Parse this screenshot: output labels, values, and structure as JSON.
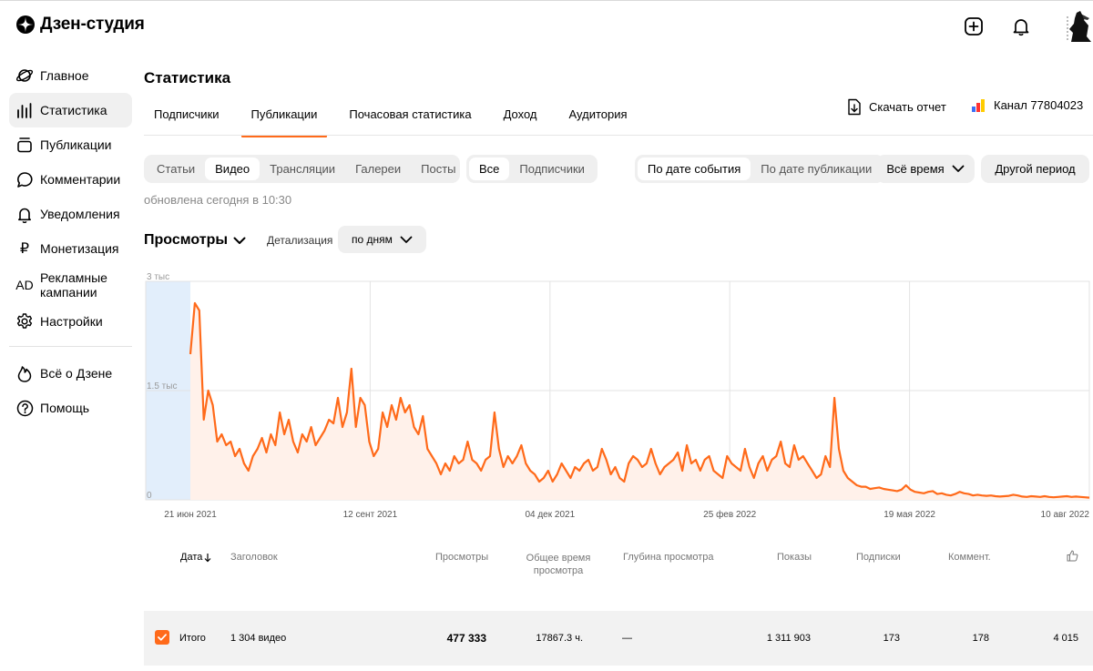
{
  "app": {
    "title": "Дзен-студия",
    "icons": {
      "logo": "zen-logo-icon",
      "add": "add-square-icon",
      "bell": "bell-icon",
      "avatar": "user-avatar"
    }
  },
  "sidebar": {
    "items": [
      {
        "label": "Главное",
        "icon": "planet-icon"
      },
      {
        "label": "Статистика",
        "icon": "bar-chart-icon",
        "active": true
      },
      {
        "label": "Публикации",
        "icon": "publications-icon"
      },
      {
        "label": "Комментарии",
        "icon": "comment-icon"
      },
      {
        "label": "Уведомления",
        "icon": "bell-icon"
      },
      {
        "label": "Монетизация",
        "icon": "ruble-icon"
      },
      {
        "label": "Рекламные кампании",
        "icon": "ad-icon",
        "icon_text": "AD"
      },
      {
        "label": "Настройки",
        "icon": "gear-icon"
      }
    ],
    "secondary": [
      {
        "label": "Всё о Дзене",
        "icon": "flame-icon"
      },
      {
        "label": "Помощь",
        "icon": "help-icon"
      }
    ]
  },
  "page": {
    "title": "Статистика",
    "tabs": [
      "Подписчики",
      "Публикации",
      "Почасовая статистика",
      "Доход",
      "Аудитория"
    ],
    "active_tab": "Публикации",
    "download_label": "Скачать отчет",
    "channel_label": "Канал 77804023"
  },
  "filters": {
    "content_types": [
      "Статьи",
      "Видео",
      "Трансляции",
      "Галереи",
      "Посты"
    ],
    "content_selected": "Видео",
    "audience": [
      "Все",
      "Подписчики"
    ],
    "audience_selected": "Все",
    "date_mode": [
      "По дате события",
      "По дате публикации"
    ],
    "date_mode_selected": "По дате события",
    "period_label": "Всё время",
    "other_period_label": "Другой период",
    "updated_text": "обновлена сегодня в 10:30"
  },
  "metric": {
    "label": "Просмотры",
    "detail_label": "Детализация",
    "detail_value": "по дням"
  },
  "chart_data": {
    "type": "area",
    "y_tick_labels": [
      "3 тыс",
      "1.5 тыс",
      "0"
    ],
    "y_ticks": [
      3000,
      1500,
      0
    ],
    "ylim": [
      0,
      3000
    ],
    "x_tick_labels": [
      "21 июн 2021",
      "12 сент 2021",
      "04 дек 2021",
      "25 фев 2022",
      "19 мая 2022",
      "10 авг 2022"
    ],
    "grid": true,
    "color": "#ff6a1a",
    "fill": "#fff1ea",
    "highlight_color": "#e2eefb",
    "series": [
      {
        "values": [
          2000,
          2700,
          2600,
          1100,
          1500,
          1300,
          800,
          900,
          750,
          800,
          600,
          700,
          500,
          400,
          600,
          700,
          850,
          650,
          900,
          750,
          1200,
          900,
          1100,
          800,
          650,
          900,
          800,
          1000,
          750,
          850,
          950,
          1100,
          1050,
          1400,
          1000,
          1200,
          1800,
          1000,
          1400,
          1300,
          800,
          600,
          700,
          1200,
          1000,
          1300,
          1100,
          1400,
          1200,
          1300,
          1000,
          900,
          1150,
          700,
          600,
          500,
          350,
          500,
          400,
          600,
          500,
          550,
          800,
          550,
          500,
          400,
          550,
          600,
          1200,
          700,
          450,
          600,
          500,
          600,
          750,
          500,
          400,
          350,
          250,
          300,
          400,
          250,
          350,
          500,
          400,
          300,
          450,
          400,
          500,
          550,
          400,
          450,
          700,
          550,
          350,
          450,
          300,
          250,
          500,
          600,
          550,
          450,
          500,
          700,
          500,
          350,
          450,
          500,
          550,
          650,
          400,
          750,
          500,
          550,
          400,
          550,
          600,
          400,
          350,
          300,
          600,
          500,
          450,
          400,
          700,
          450,
          300,
          500,
          600,
          400,
          550,
          600,
          800,
          500,
          450,
          750,
          550,
          600,
          500,
          400,
          300,
          350,
          600,
          450,
          1400,
          700,
          400,
          300,
          250,
          200,
          180,
          180,
          150,
          160,
          170,
          150,
          140,
          130,
          120,
          140,
          200,
          140,
          110,
          100,
          90,
          110,
          120,
          80,
          90,
          70,
          60,
          80,
          110,
          90,
          80,
          60,
          70,
          60,
          55,
          60,
          50,
          45,
          50,
          55,
          70,
          60,
          45,
          40,
          50,
          45,
          40,
          50,
          40,
          35,
          40,
          45,
          50,
          40,
          45,
          40,
          35,
          30
        ]
      }
    ]
  },
  "table": {
    "columns": [
      "Дата",
      "Заголовок",
      "Просмотры",
      "Общее время просмотра",
      "Глубина просмотра",
      "Показы",
      "Подписки",
      "Коммент.",
      "like-icon"
    ],
    "total": {
      "label": "Итого",
      "title": "1 304 видео",
      "views": "477 333",
      "time": "17867.3 ч.",
      "depth": "—",
      "impressions": "1 311 903",
      "subs": "173",
      "comments": "178",
      "likes": "4 015"
    }
  }
}
